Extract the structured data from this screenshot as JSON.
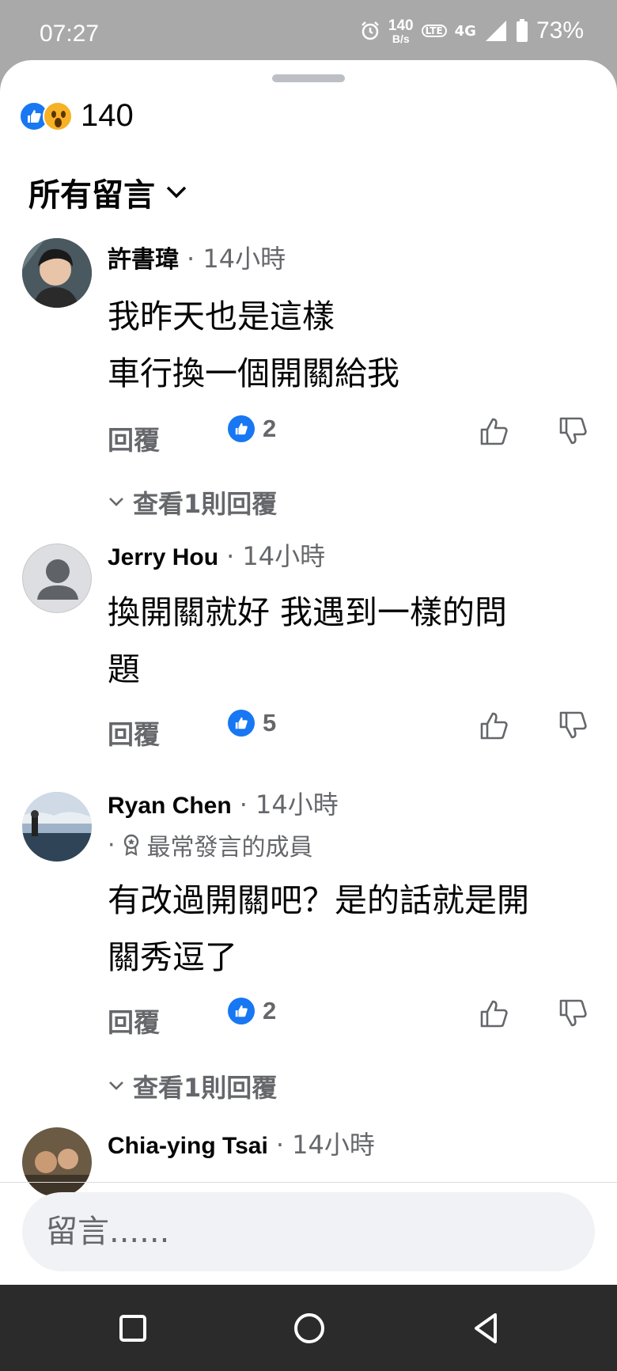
{
  "status_bar": {
    "time": "07:27",
    "net_speed": "140",
    "net_unit": "B/s",
    "volte": "LTE",
    "network": "4G",
    "battery": "73%"
  },
  "reactions": {
    "count": "140",
    "icons": [
      "like-icon",
      "wow-icon"
    ]
  },
  "filter": {
    "label": "所有留言"
  },
  "comments": [
    {
      "name": "許書瑋",
      "time": "· 14小時",
      "lines": [
        "我昨天也是這樣",
        "車行換一個開關給我"
      ],
      "reply": "回覆",
      "likes": "2",
      "view_replies": "查看1則回覆"
    },
    {
      "name": "Jerry Hou",
      "time": "· 14小時",
      "lines": [
        "換開關就好 我遇到一樣的問",
        "題"
      ],
      "reply": "回覆",
      "likes": "5"
    },
    {
      "name": "Ryan Chen",
      "time": "· 14小時",
      "badge": "最常發言的成員",
      "lines": [
        "有改過開關吧？是的話就是開",
        "關秀逗了"
      ],
      "reply": "回覆",
      "likes": "2",
      "view_replies": "查看1則回覆"
    },
    {
      "name": "Chia-ying Tsai",
      "time": "· 14小時"
    }
  ],
  "composer": {
    "placeholder": "留言......"
  },
  "colors": {
    "accent": "#1877f2",
    "secondary_text": "#65676b",
    "status_bar": "#a9a9a9",
    "nav_bar": "#2b2b2b"
  }
}
